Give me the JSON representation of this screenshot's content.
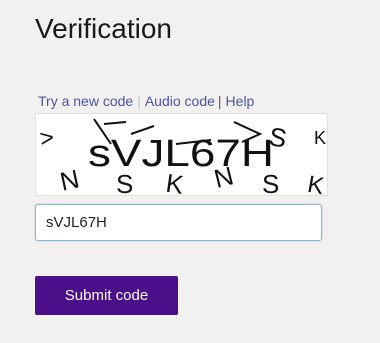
{
  "page": {
    "title": "Verification"
  },
  "links": {
    "new_code": "Try a new code",
    "audio_code": "Audio code",
    "help": "Help",
    "sep1": "|",
    "sep2": "|"
  },
  "captcha": {
    "code_text": "sVJL67H",
    "row1_left": ">",
    "row1_right": "S",
    "row1_k": "K",
    "row2": [
      "N",
      "S",
      "K",
      "N",
      "S",
      "K"
    ]
  },
  "form": {
    "code_value": "sVJL67H",
    "submit_label": "Submit code"
  },
  "colors": {
    "background": "#f2f1f0",
    "link": "#4a55a8",
    "button": "#4b0f89",
    "input_border": "#7fb8e0"
  }
}
